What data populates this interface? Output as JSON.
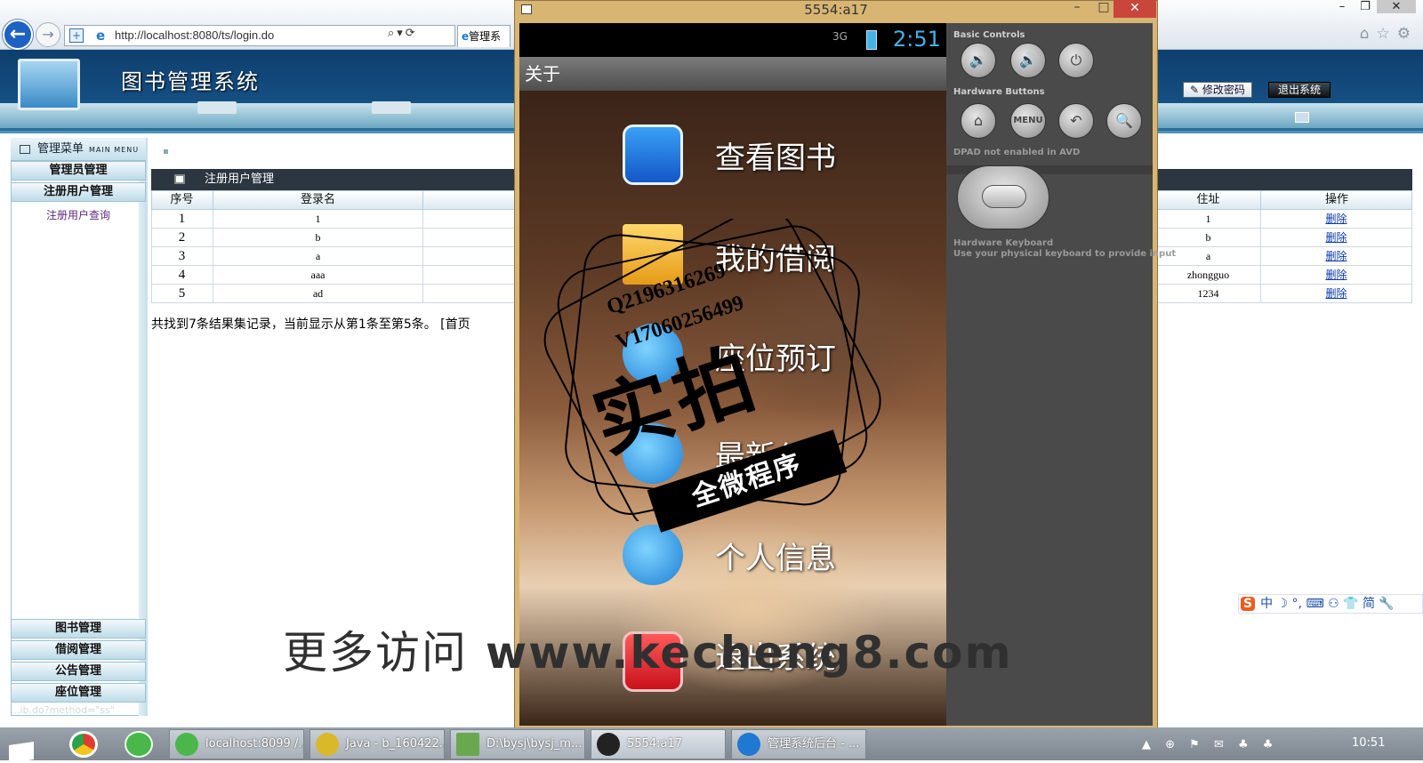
{
  "browser": {
    "url": "http://localhost:8080/ts/login.do",
    "tab_label": "管理系",
    "window_controls": [
      "–",
      "❐",
      "✕"
    ],
    "right_icons": [
      "⌂",
      "☆",
      "⚙"
    ]
  },
  "page": {
    "system_title": "图书管理系统",
    "change_password": "修改密码",
    "logout": "退出系统",
    "left_menu": {
      "header": "管理菜单",
      "header_sub": "MAIN MENU",
      "sections": [
        "管理员管理",
        "注册用户管理"
      ],
      "active_link": "注册用户查询",
      "bottom_sections": [
        "图书管理",
        "借阅管理",
        "公告管理",
        "座位管理"
      ],
      "status_fragment": "...ib.do?method=\"ss\""
    },
    "main": {
      "panel_title": "注册用户管理",
      "columns": {
        "index": "序号",
        "login": "登录名",
        "address": "住址",
        "action": "操作"
      },
      "rows": [
        {
          "index": "1",
          "login": "1",
          "address": "1",
          "action": "删除"
        },
        {
          "index": "2",
          "login": "b",
          "address": "b",
          "action": "删除"
        },
        {
          "index": "3",
          "login": "a",
          "address": "a",
          "action": "删除"
        },
        {
          "index": "4",
          "login": "aaa",
          "address": "zhongguo",
          "action": "删除"
        },
        {
          "index": "5",
          "login": "ad",
          "address": "1234",
          "action": "删除"
        }
      ],
      "summary": "共找到7条结果集记录，当前显示从第1条至第5条。 [首页"
    }
  },
  "emulator": {
    "title": "5554:a17",
    "clock": "2:51",
    "signal": "3G",
    "action_bar_title": "关于",
    "menu_items": [
      "查看图书",
      "我的借阅",
      "座位预订",
      "最新公告",
      "个人信息",
      "退出系统"
    ],
    "controls": {
      "basic_label": "Basic Controls",
      "hardware_label": "Hardware Buttons",
      "dpad_label": "DPAD not enabled in AVD",
      "keyboard_label": "Hardware Keyboard",
      "keyboard_desc": "Use your physical keyboard to provide input",
      "basic_icons": [
        "🔉",
        "🔊",
        "⏻"
      ],
      "hardware_icons": [
        "⌂",
        "MENU",
        "↶",
        "🔍"
      ]
    }
  },
  "watermark": {
    "qq": "Q2196316269",
    "vx": "V17060256499",
    "big": "实拍",
    "ribbon": "全微程序",
    "footer_prefix": "更多访问",
    "footer_url": "www.kecheng8.com"
  },
  "ime": {
    "logo": "S",
    "items": "中 ☽ °, ⌨ ⚇ 👕 简 🔧"
  },
  "taskbar": {
    "items": [
      "localhost:8099 /...",
      "Java - b_160422...",
      "D:\\bysj\\bysj_m...",
      "5554:a17",
      "管理系统后台 - ..."
    ],
    "clock": "10:51",
    "tray": "▲ ⊕ ⚑ ✉ ♣ ♣"
  },
  "colors": {
    "banner": "#144e80",
    "menu_link": "#5b2b7e",
    "emulator_frame": "#d8b572",
    "clock": "#41b3ea",
    "delete_link": "#0a3aa8"
  }
}
